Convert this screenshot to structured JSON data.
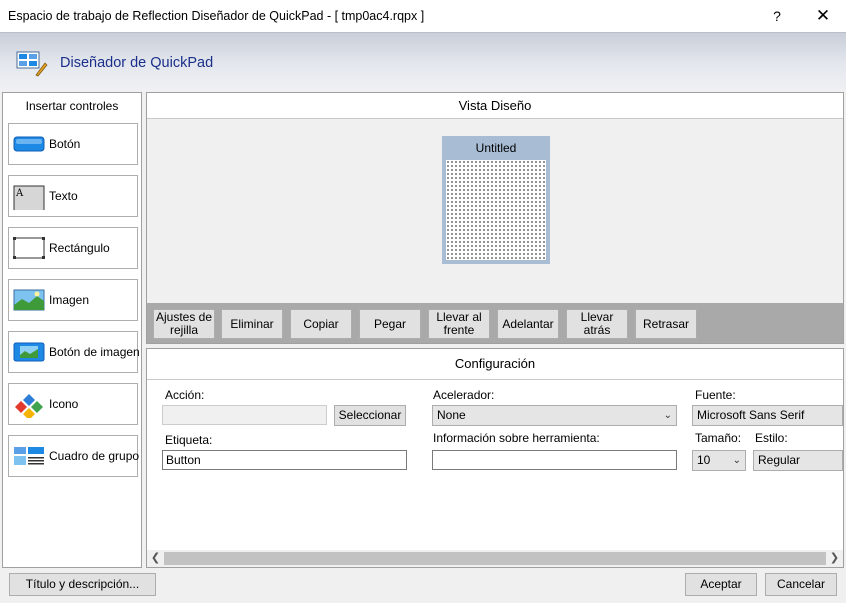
{
  "window": {
    "title": "Espacio de trabajo de Reflection Diseñador de QuickPad - [ tmp0ac4.rqpx ]",
    "help_label": "?",
    "close_label": "✕"
  },
  "header": {
    "title": "Diseñador de QuickPad",
    "icon": "quickpad-designer-icon"
  },
  "left_panel": {
    "title": "Insertar controles",
    "tools": [
      {
        "label": "Botón",
        "icon": "button-control-icon"
      },
      {
        "label": "Texto",
        "icon": "text-control-icon"
      },
      {
        "label": "Rectángulo",
        "icon": "rectangle-control-icon"
      },
      {
        "label": "Imagen",
        "icon": "image-control-icon"
      },
      {
        "label": "Botón de imagen",
        "icon": "image-button-control-icon"
      },
      {
        "label": "Icono",
        "icon": "icon-control-icon"
      },
      {
        "label": "Cuadro de grupo",
        "icon": "group-box-control-icon"
      }
    ]
  },
  "design_view": {
    "title": "Vista Diseño",
    "quickpad_title": "Untitled",
    "toolbar": [
      {
        "label": "Ajustes de rejilla"
      },
      {
        "label": "Eliminar"
      },
      {
        "label": "Copiar"
      },
      {
        "label": "Pegar"
      },
      {
        "label": "Llevar al frente"
      },
      {
        "label": "Adelantar"
      },
      {
        "label": "Llevar atrás"
      },
      {
        "label": "Retrasar"
      }
    ]
  },
  "config": {
    "title": "Configuración",
    "accion_label": "Acción:",
    "accion_value": "",
    "select_button": "Seleccionar",
    "etiqueta_label": "Etiqueta:",
    "etiqueta_value": "Button",
    "acelerador_label": "Acelerador:",
    "acelerador_value": "None",
    "tooltip_label": "Información sobre herramienta:",
    "tooltip_value": "",
    "fuente_label": "Fuente:",
    "fuente_value": "Microsoft Sans Serif",
    "tamano_label": "Tamaño:",
    "tamano_value": "10",
    "estilo_label": "Estilo:",
    "estilo_value": "Regular"
  },
  "footer": {
    "title_desc_button": "Título y descripción...",
    "accept_button": "Aceptar",
    "cancel_button": "Cancelar"
  },
  "colors": {
    "header_title": "#1a2f8a",
    "quickpad_frame": "#a8bcd4",
    "toolbar_bg": "#a9a9a9"
  }
}
